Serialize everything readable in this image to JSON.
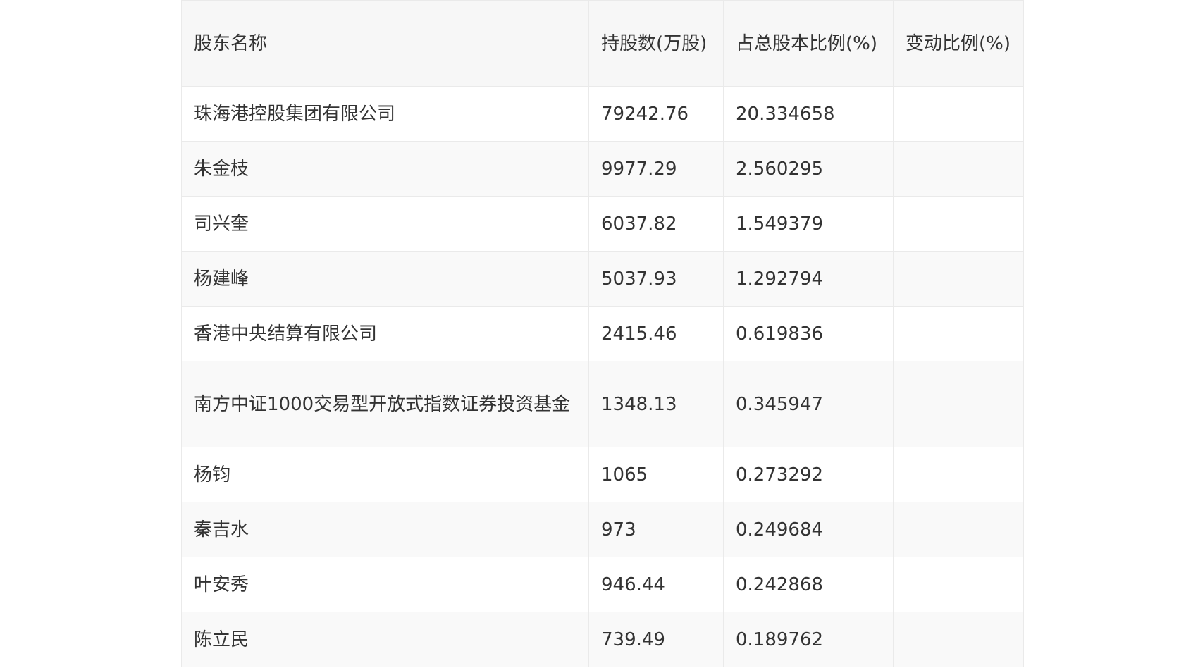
{
  "table": {
    "headers": [
      "股东名称",
      "持股数(万股)",
      "占总股本比例(%)",
      "变动比例(%)"
    ],
    "rows": [
      {
        "name": "珠海港控股集团有限公司",
        "shares": "79242.76",
        "ratio": "20.334658",
        "change": ""
      },
      {
        "name": "朱金枝",
        "shares": "9977.29",
        "ratio": "2.560295",
        "change": ""
      },
      {
        "name": "司兴奎",
        "shares": "6037.82",
        "ratio": "1.549379",
        "change": ""
      },
      {
        "name": "杨建峰",
        "shares": "5037.93",
        "ratio": "1.292794",
        "change": ""
      },
      {
        "name": "香港中央结算有限公司",
        "shares": "2415.46",
        "ratio": "0.619836",
        "change": ""
      },
      {
        "name": "南方中证1000交易型开放式指数证券投资基金",
        "shares": "1348.13",
        "ratio": "0.345947",
        "change": ""
      },
      {
        "name": "杨钧",
        "shares": "1065",
        "ratio": "0.273292",
        "change": ""
      },
      {
        "name": "秦吉水",
        "shares": "973",
        "ratio": "0.249684",
        "change": ""
      },
      {
        "name": "叶安秀",
        "shares": "946.44",
        "ratio": "0.242868",
        "change": ""
      },
      {
        "name": "陈立民",
        "shares": "739.49",
        "ratio": "0.189762",
        "change": ""
      }
    ]
  }
}
